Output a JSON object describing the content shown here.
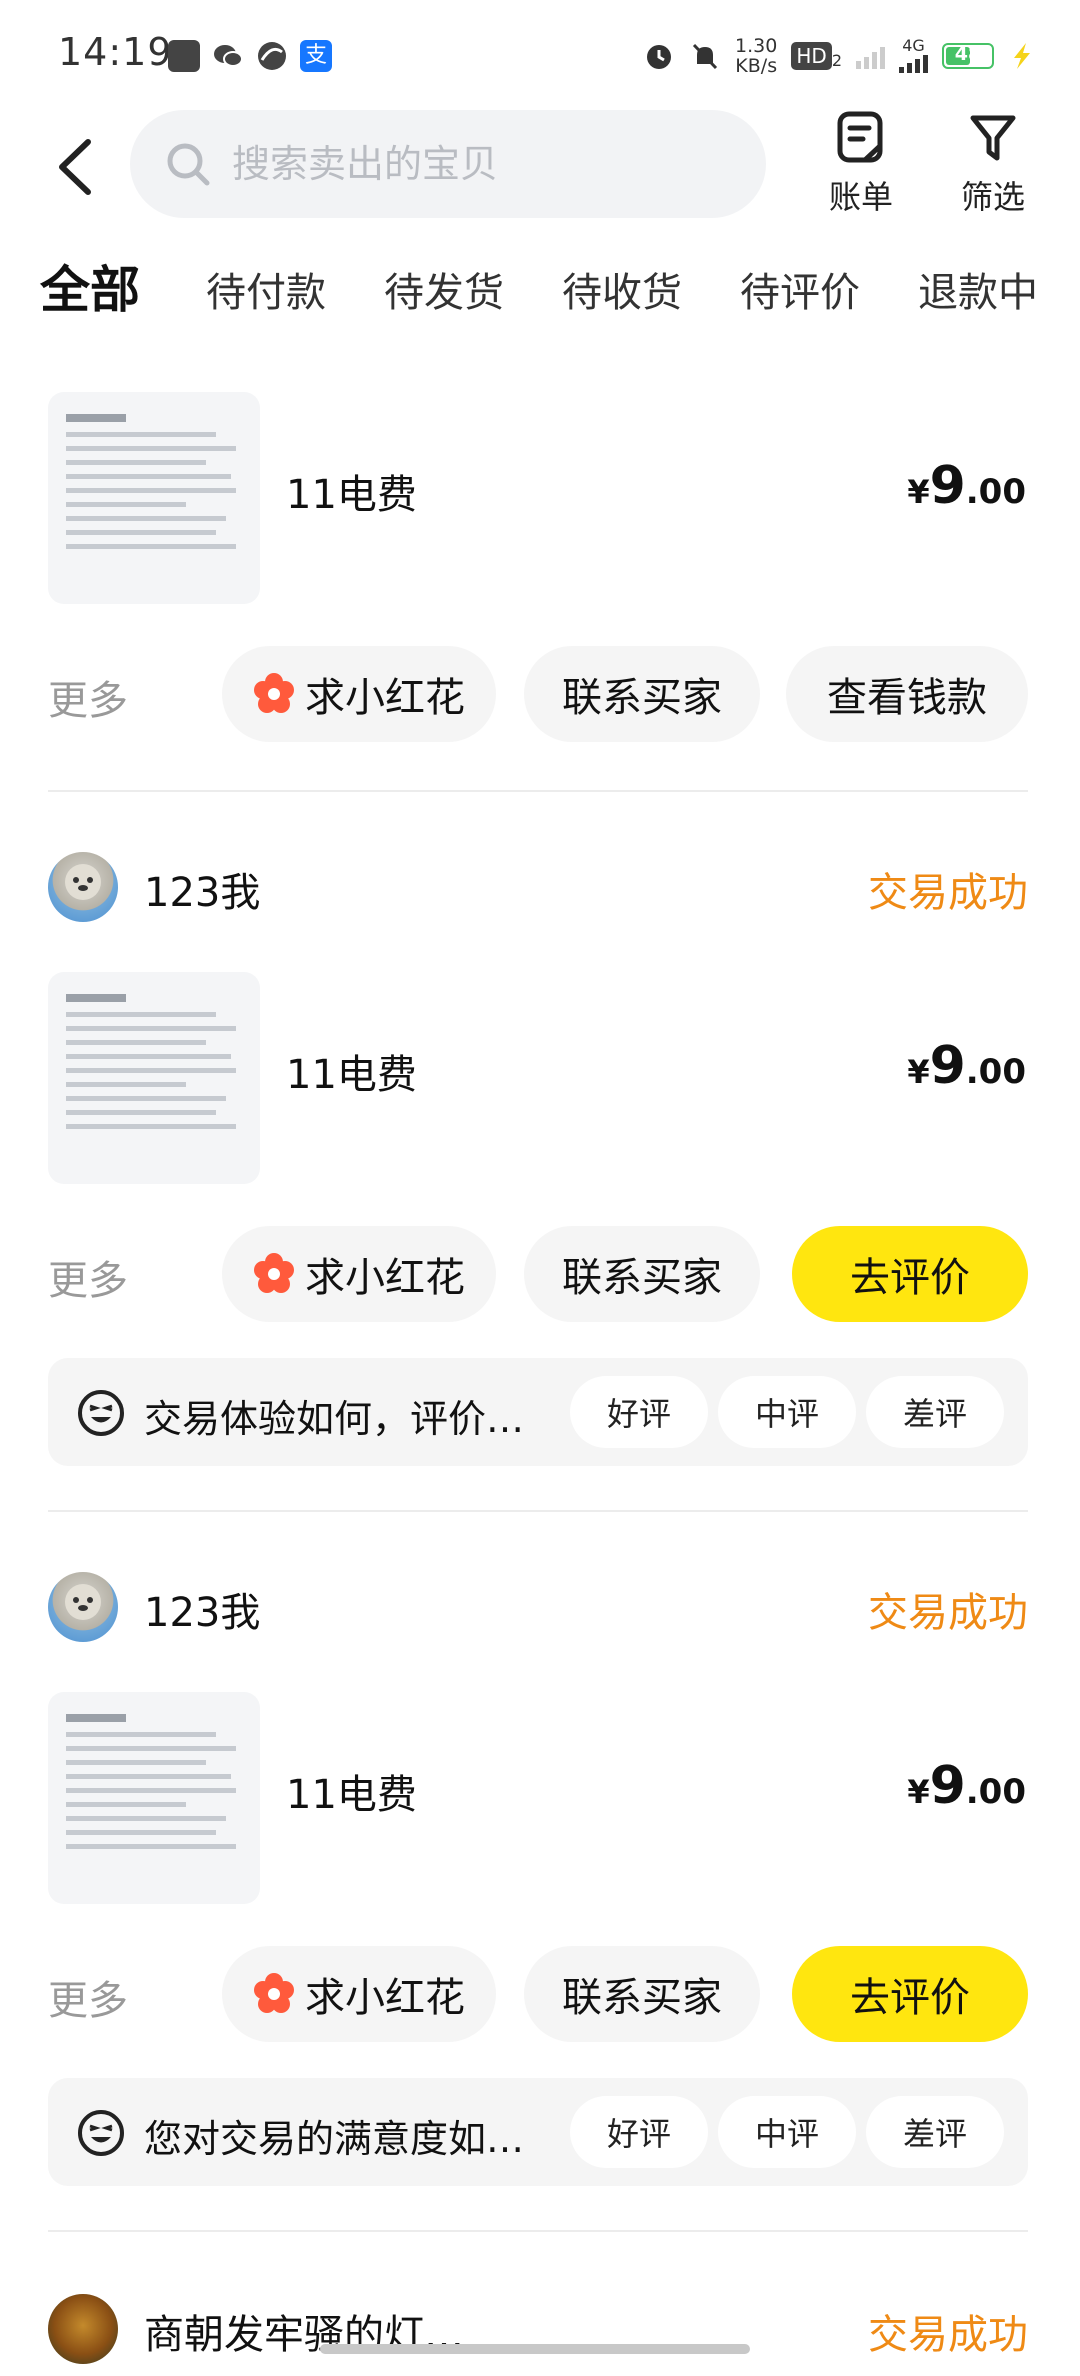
{
  "status_bar": {
    "time": "14:19",
    "net_speed_value": "1.30",
    "net_speed_unit": "KB/s",
    "hd_label": "HD",
    "hd_sub": "2",
    "network": "4G",
    "battery": "48"
  },
  "header": {
    "search_placeholder": "搜索卖出的宝贝",
    "bill_label": "账单",
    "filter_label": "筛选"
  },
  "tabs": [
    {
      "label": "全部",
      "active": true
    },
    {
      "label": "待付款"
    },
    {
      "label": "待发货"
    },
    {
      "label": "待收货"
    },
    {
      "label": "待评价"
    },
    {
      "label": "退款中"
    }
  ],
  "orders": [
    {
      "product_title": "11电费",
      "price_currency": "¥",
      "price_int": "9",
      "price_dec": ".00",
      "more_label": "更多",
      "actions": [
        "求小红花",
        "联系买家",
        "查看钱款"
      ]
    },
    {
      "seller": "123我",
      "status": "交易成功",
      "product_title": "11电费",
      "price_currency": "¥",
      "price_int": "9",
      "price_dec": ".00",
      "more_label": "更多",
      "actions": [
        "求小红花",
        "联系买家",
        "去评价"
      ],
      "rate_prompt": "交易体验如何，评价…",
      "rate_options": [
        "好评",
        "中评",
        "差评"
      ]
    },
    {
      "seller": "123我",
      "status": "交易成功",
      "product_title": "11电费",
      "price_currency": "¥",
      "price_int": "9",
      "price_dec": ".00",
      "more_label": "更多",
      "actions": [
        "求小红花",
        "联系买家",
        "去评价"
      ],
      "rate_prompt": "您对交易的满意度如…",
      "rate_options": [
        "好评",
        "中评",
        "差评"
      ]
    },
    {
      "seller": "商朝发牢骚的灯…",
      "status": "交易成功"
    }
  ],
  "colors": {
    "accent_yellow": "#ffe60f",
    "status_orange": "#ef8a15",
    "flower_red": "#ff5a3c"
  }
}
